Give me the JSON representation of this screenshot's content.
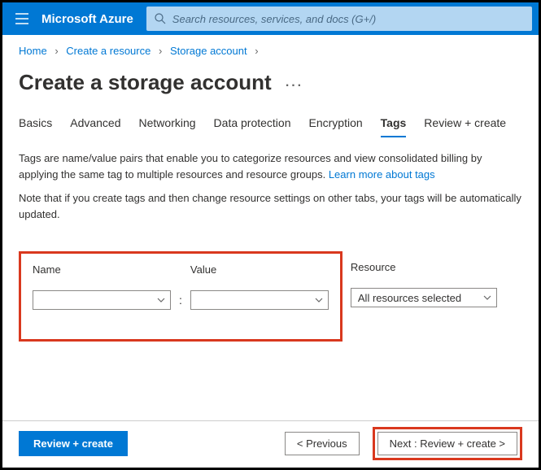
{
  "header": {
    "brand": "Microsoft Azure",
    "search_placeholder": "Search resources, services, and docs (G+/)"
  },
  "breadcrumbs": {
    "items": [
      "Home",
      "Create a resource",
      "Storage account"
    ]
  },
  "page": {
    "title": "Create a storage account"
  },
  "tabs": {
    "items": [
      "Basics",
      "Advanced",
      "Networking",
      "Data protection",
      "Encryption",
      "Tags",
      "Review + create"
    ],
    "active_index": 5
  },
  "body": {
    "p1_a": "Tags are name/value pairs that enable you to categorize resources and view consolidated billing by applying the same tag to multiple resources and resource groups. ",
    "p1_link": "Learn more about tags",
    "p2": "Note that if you create tags and then change resource settings on other tabs, your tags will be automatically updated."
  },
  "tag_form": {
    "name_label": "Name",
    "value_label": "Value",
    "resource_label": "Resource",
    "resource_selected": "All resources selected"
  },
  "footer": {
    "review_create": "Review + create",
    "previous": "< Previous",
    "next": "Next : Review + create >"
  }
}
